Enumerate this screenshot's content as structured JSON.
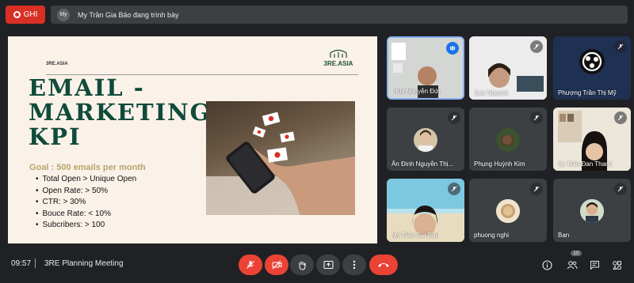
{
  "top": {
    "record_label": "GHI",
    "presenter_initials": "My",
    "presenter_text": "My Trần Gia Bảo đang trình bày"
  },
  "slide": {
    "small_logo": "3RE.ASIA",
    "logo": "3RE.ASIA",
    "title_lines": [
      "EMAIL -",
      "MARKETING",
      "KPI"
    ],
    "goal": "Goal : 500 emails per month",
    "items": [
      "Total Open > Unique Open",
      "Open Rate: > 50%",
      "CTR: > 30%",
      "Bouce Rate: < 10%",
      "Subcribers: > 100"
    ]
  },
  "participants": [
    {
      "name": "Huy Nguyễn Đức",
      "mic": "speaking"
    },
    {
      "name": "Quy Nguyen",
      "mic": "off"
    },
    {
      "name": "Phượng Trần Thị Mỹ",
      "mic": "off"
    },
    {
      "name": "Ân Đinh Nguyễn Thị...",
      "mic": "off"
    },
    {
      "name": "Phụng Huỳnh Kim",
      "mic": "off"
    },
    {
      "name": "Vy Trần Đan Thanh",
      "mic": "off"
    },
    {
      "name": "My Trần Gia Bảo",
      "mic": "off"
    },
    {
      "name": "phuong nghi",
      "mic": "off"
    },
    {
      "name": "Bạn",
      "mic": "off"
    }
  ],
  "bottom": {
    "time": "09:57",
    "meeting_name": "3RE Planning Meeting",
    "participant_count": "10"
  },
  "colors": {
    "accent_red": "#ea4335",
    "slide_title": "#0f4b3b",
    "slide_goal": "#b7a56a",
    "background": "#202124"
  }
}
